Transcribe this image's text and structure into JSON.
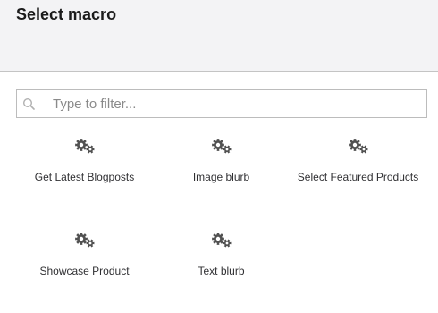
{
  "dialog": {
    "title": "Select macro"
  },
  "filter": {
    "placeholder": "Type to filter...",
    "value": ""
  },
  "macros": [
    {
      "label": "Get Latest Blogposts",
      "icon": "settings-gears-icon"
    },
    {
      "label": "Image blurb",
      "icon": "settings-gears-icon"
    },
    {
      "label": "Select Featured Products",
      "icon": "settings-gears-icon"
    },
    {
      "label": "Showcase Product",
      "icon": "settings-gears-icon"
    },
    {
      "label": "Text blurb",
      "icon": "settings-gears-icon"
    }
  ],
  "colors": {
    "header_bg": "#f3f3f5",
    "icon": "#515151",
    "text": "#303033"
  }
}
